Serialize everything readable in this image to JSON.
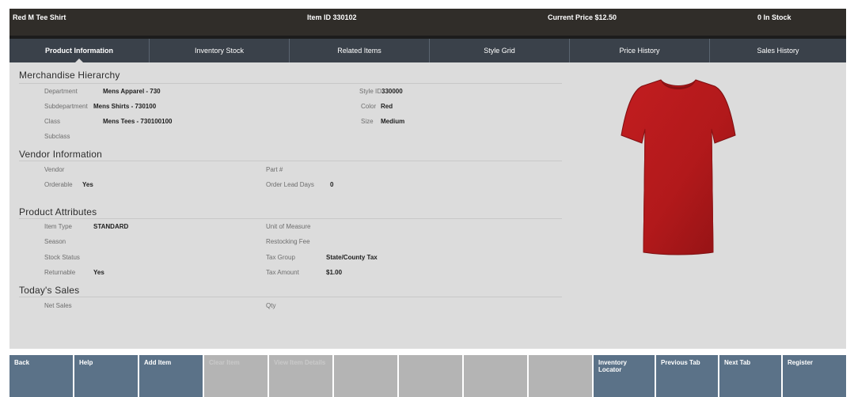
{
  "header": {
    "item_name": "Red M Tee Shirt",
    "item_id": "Item ID 330102",
    "current_price": "Current Price $12.50",
    "stock": "0 In Stock"
  },
  "tabs": [
    {
      "label": "Product Information",
      "active": true
    },
    {
      "label": "Inventory Stock"
    },
    {
      "label": "Related Items"
    },
    {
      "label": "Style Grid"
    },
    {
      "label": "Price History"
    },
    {
      "label": "Sales History"
    }
  ],
  "merchandise": {
    "title": "Merchandise Hierarchy",
    "department_label": "Department",
    "department_value": "Mens Apparel - 730",
    "subdepartment_label": "Subdepartment",
    "subdepartment_value": "Mens Shirts - 730100",
    "class_label": "Class",
    "class_value": "Mens Tees - 730100100",
    "subclass_label": "Subclass",
    "style_id_label": "Style ID",
    "style_id_value": "330000",
    "color_label": "Color",
    "color_value": "Red",
    "size_label": "Size",
    "size_value": "Medium"
  },
  "vendor": {
    "title": "Vendor Information",
    "vendor_label": "Vendor",
    "orderable_label": "Orderable",
    "orderable_value": "Yes",
    "part_label": "Part #",
    "lead_label": "Order Lead Days",
    "lead_value": "0"
  },
  "attributes": {
    "title": "Product Attributes",
    "item_type_label": "Item Type",
    "item_type_value": "STANDARD",
    "season_label": "Season",
    "stock_status_label": "Stock Status",
    "returnable_label": "Returnable",
    "returnable_value": "Yes",
    "uom_label": "Unit of Measure",
    "restocking_label": "Restocking Fee",
    "tax_group_label": "Tax Group",
    "tax_group_value": "State/County Tax",
    "tax_amount_label": "Tax Amount",
    "tax_amount_value": "$1.00"
  },
  "sales": {
    "title": "Today's Sales",
    "net_sales_label": "Net Sales",
    "qty_label": "Qty"
  },
  "buttons": [
    {
      "label": "Back"
    },
    {
      "label": "Help"
    },
    {
      "label": "Add Item"
    },
    {
      "label": "Clear Item",
      "disabled": true
    },
    {
      "label": "View Item Details",
      "disabled": true
    },
    {
      "label": "",
      "disabled": true
    },
    {
      "label": "",
      "disabled": true
    },
    {
      "label": "",
      "disabled": true
    },
    {
      "label": "Inventory Locator"
    },
    {
      "label": "Previous Tab"
    },
    {
      "label": "Next Tab"
    },
    {
      "label": "Register"
    }
  ],
  "colors": {
    "header_bg": "#302d29",
    "tabbar_bg": "#3a414a",
    "content_bg": "#dcdcdc",
    "button_bg": "#5b7288",
    "button_disabled_bg": "#b4b4b4",
    "shirt_red": "#b2191b"
  },
  "icons": {
    "product_image": "red-tee-shirt-image"
  }
}
